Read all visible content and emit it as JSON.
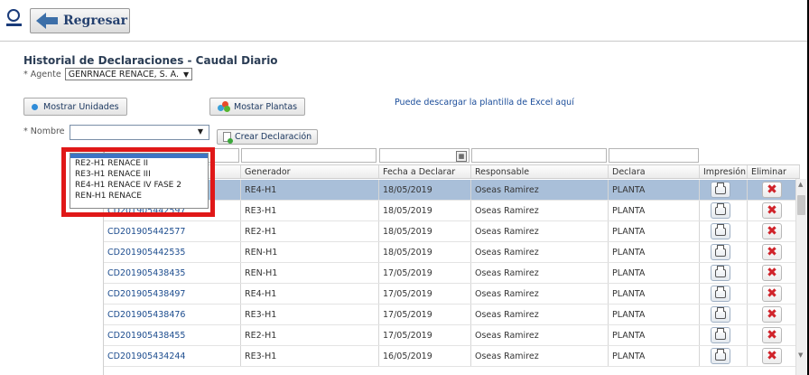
{
  "header": {
    "back_label": "Regresar"
  },
  "page": {
    "title": "Historial de Declaraciones - Caudal Diario",
    "agent_label": "* Agente",
    "agent_value": "GENRNACE RENACE, S. A.",
    "show_units_label": "Mostrar Unidades",
    "show_plants_label": "Mostar Plantas",
    "excel_link": "Puede descargar la plantilla de Excel aquí",
    "nombre_label": "* Nombre",
    "nombre_value": "",
    "create_label": "Crear Declaración"
  },
  "dropdown": {
    "options": [
      "RE2-H1 RENACE II",
      "RE3-H1 RENACE III",
      "RE4-H1 RENACE IV FASE 2",
      "REN-H1 RENACE"
    ]
  },
  "table": {
    "headers": [
      "",
      "Generador",
      "Fecha a Declarar",
      "Responsable",
      "Declara",
      "Impresión",
      "Eliminar"
    ],
    "rows": [
      {
        "codigo": "",
        "generador": "RE4-H1",
        "fecha": "18/05/2019",
        "responsable": "Oseas Ramirez",
        "declara": "PLANTA",
        "selected": true
      },
      {
        "codigo": "CD201905442597",
        "generador": "RE3-H1",
        "fecha": "18/05/2019",
        "responsable": "Oseas Ramirez",
        "declara": "PLANTA"
      },
      {
        "codigo": "CD201905442577",
        "generador": "RE2-H1",
        "fecha": "18/05/2019",
        "responsable": "Oseas Ramirez",
        "declara": "PLANTA"
      },
      {
        "codigo": "CD201905442535",
        "generador": "REN-H1",
        "fecha": "18/05/2019",
        "responsable": "Oseas Ramirez",
        "declara": "PLANTA"
      },
      {
        "codigo": "CD201905438435",
        "generador": "REN-H1",
        "fecha": "17/05/2019",
        "responsable": "Oseas Ramirez",
        "declara": "PLANTA"
      },
      {
        "codigo": "CD201905438497",
        "generador": "RE4-H1",
        "fecha": "17/05/2019",
        "responsable": "Oseas Ramirez",
        "declara": "PLANTA"
      },
      {
        "codigo": "CD201905438476",
        "generador": "RE3-H1",
        "fecha": "17/05/2019",
        "responsable": "Oseas Ramirez",
        "declara": "PLANTA"
      },
      {
        "codigo": "CD201905438455",
        "generador": "RE2-H1",
        "fecha": "17/05/2019",
        "responsable": "Oseas Ramirez",
        "declara": "PLANTA"
      },
      {
        "codigo": "CD201905434244",
        "generador": "RE3-H1",
        "fecha": "16/05/2019",
        "responsable": "Oseas Ramirez",
        "declara": "PLANTA"
      }
    ]
  },
  "icons": {
    "back": "arrow-left-icon",
    "print": "printer-icon",
    "delete": "delete-x-icon",
    "calendar": "calendar-icon"
  },
  "colors": {
    "selected_row": "#a9bfd9",
    "link": "#1c4c8e",
    "delete": "#d0232a",
    "highlight_box": "#e01818"
  }
}
